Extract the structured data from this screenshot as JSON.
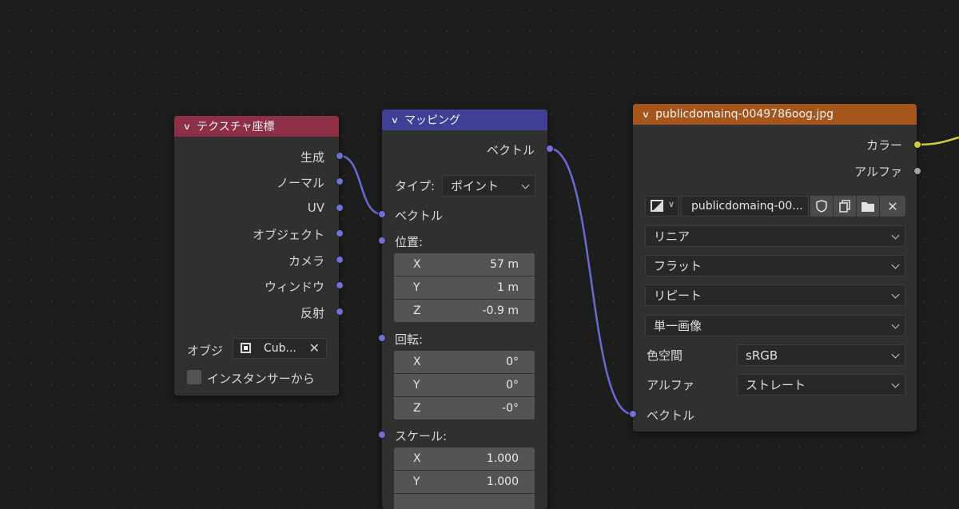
{
  "nodes": {
    "texcoord": {
      "title": "テクスチャ座標",
      "outputs": [
        "生成",
        "ノーマル",
        "UV",
        "オブジェクト",
        "カメラ",
        "ウィンドウ",
        "反射"
      ],
      "object_label": "オブジ",
      "object_value": "Cub...",
      "instancer_label": "インスタンサーから",
      "header_color": "#8e2f48"
    },
    "mapping": {
      "title": "マッピング",
      "output": "ベクトル",
      "type_label": "タイプ:",
      "type_value": "ポイント",
      "vector_input": "ベクトル",
      "location_label": "位置:",
      "location": [
        {
          "axis": "X",
          "value": "57 m"
        },
        {
          "axis": "Y",
          "value": "1 m"
        },
        {
          "axis": "Z",
          "value": "-0.9 m"
        }
      ],
      "rotation_label": "回転:",
      "rotation": [
        {
          "axis": "X",
          "value": "0°"
        },
        {
          "axis": "Y",
          "value": "0°"
        },
        {
          "axis": "Z",
          "value": "-0°"
        }
      ],
      "scale_label": "スケール:",
      "scale": [
        {
          "axis": "X",
          "value": "1.000"
        },
        {
          "axis": "Y",
          "value": "1.000"
        }
      ],
      "header_color": "#3f3f96"
    },
    "image": {
      "title": "publicdomainq-0049786oog.jpg",
      "outputs": [
        "カラー",
        "アルファ"
      ],
      "image_name": "publicdomainq-00...",
      "interpolation": "リニア",
      "projection": "フラット",
      "extension": "リピート",
      "source": "単一画像",
      "colorspace_label": "色空間",
      "colorspace_value": "sRGB",
      "alpha_label": "アルファ",
      "alpha_value": "ストレート",
      "vector_input": "ベクトル",
      "header_color": "#a5561d"
    }
  },
  "colors": {
    "socket_vector": "#6f6fd6",
    "socket_color": "#d2ca3f",
    "socket_float": "#a3a3a3",
    "link_vector": "#6a6ad0",
    "link_color": "#d2ca3f"
  }
}
